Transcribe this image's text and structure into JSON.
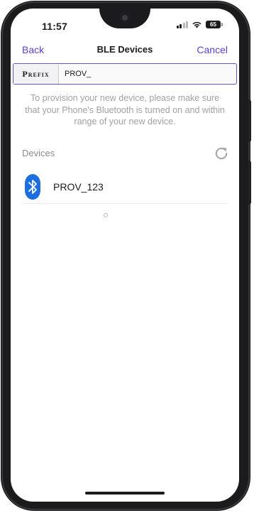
{
  "status_bar": {
    "time": "11:57",
    "battery": "65"
  },
  "navbar": {
    "back_label": "Back",
    "title": "BLE Devices",
    "cancel_label": "Cancel"
  },
  "prefix": {
    "label": "Prefix",
    "value": "PROV_"
  },
  "hint": "To provision your new device, please make sure that your Phone's Bluetooth is turned on and within range of your new device.",
  "devices": {
    "header": "Devices",
    "items": [
      {
        "name": "PROV_123",
        "icon": "bluetooth-icon"
      }
    ]
  },
  "colors": {
    "accent": "#5b3fc9",
    "bluetooth": "#1d6fe0"
  }
}
